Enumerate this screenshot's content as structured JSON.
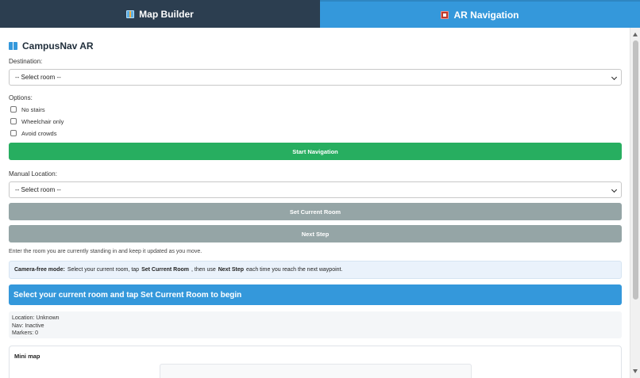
{
  "tabs": [
    {
      "label": "Map Builder",
      "icon": "map-icon",
      "color": "#2c3e50"
    },
    {
      "label": "AR Navigation",
      "icon": "ar-icon",
      "color": "#3498db",
      "active": true
    }
  ],
  "app": {
    "title": "CampusNav AR",
    "icon": "book-icon"
  },
  "destination": {
    "label": "Destination:",
    "selected": "-- Select room --"
  },
  "options": {
    "label": "Options:",
    "items": [
      {
        "label": "No stairs",
        "checked": false
      },
      {
        "label": "Wheelchair only",
        "checked": false
      },
      {
        "label": "Avoid crowds",
        "checked": false
      }
    ]
  },
  "buttons": {
    "start_navigation": "Start Navigation",
    "set_current_room": "Set Current Room",
    "next_step": "Next Step"
  },
  "manual_location": {
    "label": "Manual Location:",
    "selected": "-- Select room --"
  },
  "hint": "Enter the room you are currently standing in and keep it updated as you move.",
  "info": {
    "mode": "Camera-free mode:",
    "text1": "Select your current room, tap",
    "bold1": "Set Current Room",
    "text2": ", then use",
    "bold2": "Next Step",
    "text3": "each time you reach the next waypoint."
  },
  "banner": "Select your current room and tap Set Current Room to begin",
  "status": {
    "location": "Location: Unknown",
    "nav": "Nav: Inactive",
    "markers": "Markers: 0"
  },
  "minimap": {
    "title": "Mini map"
  },
  "colors": {
    "green": "#27ae60",
    "blue": "#3498db",
    "gray": "#95a5a6",
    "navy": "#2c3e50"
  }
}
